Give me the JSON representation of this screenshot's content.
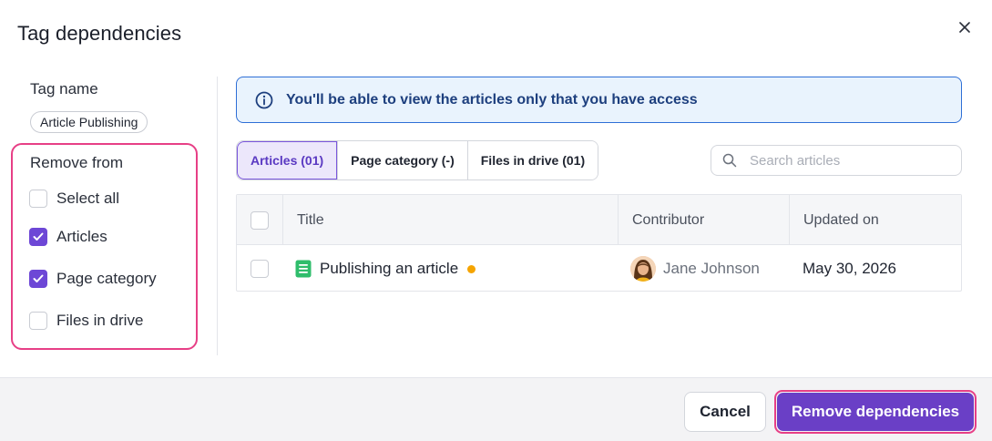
{
  "dialog": {
    "title": "Tag dependencies"
  },
  "left_panel": {
    "tag_name_label": "Tag name",
    "tag_chip": "Article Publishing",
    "remove_from_label": "Remove from",
    "options": [
      {
        "label": "Select all",
        "checked": false
      },
      {
        "label": "Articles",
        "checked": true
      },
      {
        "label": "Page category",
        "checked": true
      },
      {
        "label": "Files in drive",
        "checked": false
      }
    ]
  },
  "info_banner": {
    "text": "You'll be able to view the articles only that you have access"
  },
  "tabs": [
    {
      "label": "Articles (01)",
      "active": true
    },
    {
      "label": "Page category (-)",
      "active": false
    },
    {
      "label": "Files in drive (01)",
      "active": false
    }
  ],
  "search": {
    "placeholder": "Search articles"
  },
  "table": {
    "columns": [
      "Title",
      "Contributor",
      "Updated on"
    ],
    "rows": [
      {
        "title": "Publishing an article",
        "contributor": "Jane Johnson",
        "updated_on": "May 30, 2026"
      }
    ]
  },
  "footer": {
    "cancel_label": "Cancel",
    "primary_label": "Remove dependencies"
  },
  "colors": {
    "accent": "#6a3fc6",
    "highlight_ring": "#e73f86",
    "info_border": "#2e6fd6",
    "status_dot": "#f5a400",
    "doc_icon": "#2fbd6b"
  }
}
